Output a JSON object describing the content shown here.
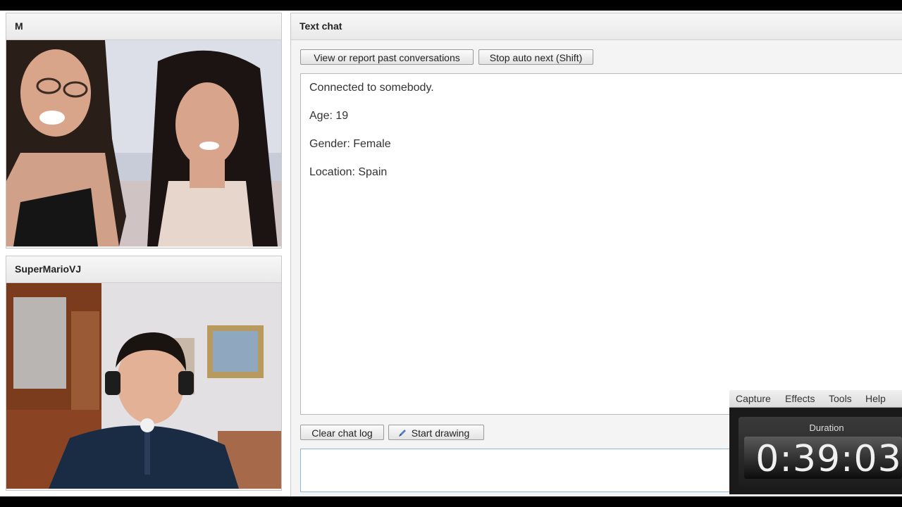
{
  "video_top": {
    "name": "M"
  },
  "video_bottom": {
    "name": "SuperMarioVJ"
  },
  "chat": {
    "title": "Text chat",
    "buttons": {
      "view_report": "View or report past conversations",
      "stop_auto_next": "Stop auto next (Shift)",
      "clear_log": "Clear chat log",
      "start_drawing": "Start drawing"
    },
    "messages": [
      "Connected to somebody.",
      "Age: 19",
      "Gender: Female",
      "Location: Spain"
    ],
    "input_value": ""
  },
  "recorder": {
    "menu": [
      "Capture",
      "Effects",
      "Tools",
      "Help"
    ],
    "duration_label": "Duration",
    "duration_value": "0:39:03"
  },
  "icons": {
    "drawing": "pencil-icon"
  }
}
